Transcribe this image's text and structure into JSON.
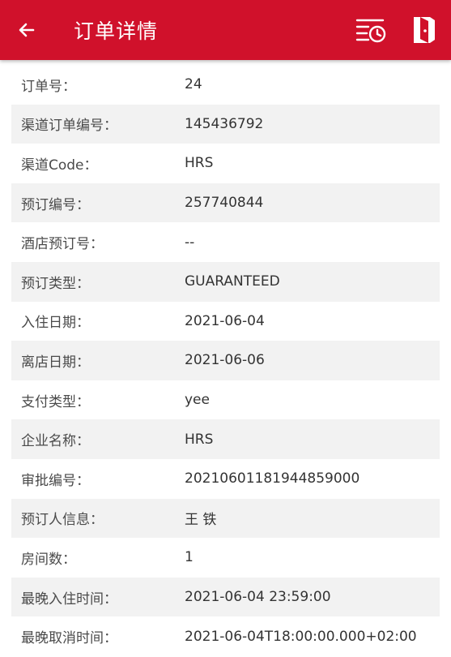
{
  "header": {
    "title": "订单详情"
  },
  "rows": [
    {
      "label": "订单号：",
      "value": "24"
    },
    {
      "label": "渠道订单编号：",
      "value": "145436792"
    },
    {
      "label": "渠道Code：",
      "value": "HRS"
    },
    {
      "label": "预订编号：",
      "value": "257740844"
    },
    {
      "label": "酒店预订号：",
      "value": "--"
    },
    {
      "label": "预订类型：",
      "value": "GUARANTEED"
    },
    {
      "label": "入住日期：",
      "value": "2021-06-04"
    },
    {
      "label": "离店日期：",
      "value": "2021-06-06"
    },
    {
      "label": "支付类型：",
      "value": "yee"
    },
    {
      "label": "企业名称：",
      "value": "HRS"
    },
    {
      "label": "审批编号：",
      "value": "20210601181944859000"
    },
    {
      "label": "预订人信息：",
      "value": "王 铁"
    },
    {
      "label": "房间数：",
      "value": "1"
    },
    {
      "label": "最晚入住时间：",
      "value": "2021-06-04 23:59:00"
    },
    {
      "label": "最晚取消时间：",
      "value": "2021-06-04T18:00:00.000+02:00"
    }
  ],
  "colors": {
    "accent": "#d0112b",
    "stripe": "#f2f2f2"
  },
  "icons": {
    "back": "arrow-left-icon",
    "history": "list-clock-icon",
    "exit": "door-exit-icon"
  }
}
